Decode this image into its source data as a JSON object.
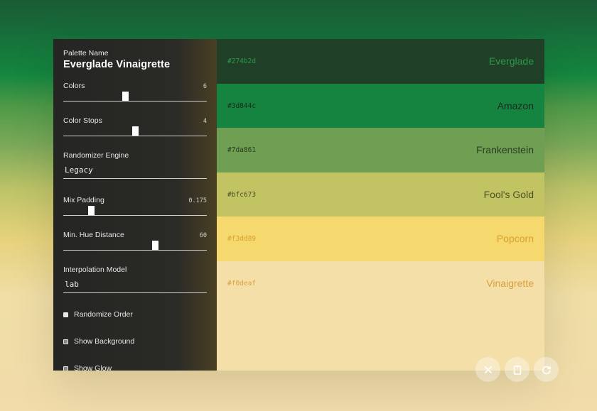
{
  "panel": {
    "title_label": "Palette Name",
    "title": "Everglade Vinaigrette",
    "colors": {
      "label": "Colors",
      "value": "6",
      "fraction": 0.43
    },
    "color_stops": {
      "label": "Color Stops",
      "value": "4",
      "fraction": 0.5
    },
    "randomizer": {
      "label": "Randomizer Engine",
      "value": "Legacy"
    },
    "mix_padding": {
      "label": "Mix Padding",
      "value": "0.175",
      "fraction": 0.18
    },
    "hue_distance": {
      "label": "Min. Hue Distance",
      "value": "60",
      "fraction": 0.65
    },
    "interpolation": {
      "label": "Interpolation Model",
      "value": "lab"
    },
    "checks": [
      {
        "label": "Randomize Order",
        "checked": false
      },
      {
        "label": "Show Background",
        "checked": true
      },
      {
        "label": "Show Glow",
        "checked": true
      }
    ]
  },
  "swatches": [
    {
      "hex": "#274b2d",
      "name": "Everglade",
      "bg": "#1f3f27",
      "fg": "#2f9a4a"
    },
    {
      "hex": "#3d844c",
      "name": "Amazon",
      "bg": "#148440",
      "fg": "#1b2a1c"
    },
    {
      "hex": "#7da861",
      "name": "Frankenstein",
      "bg": "#6f9f52",
      "fg": "#2b3a23"
    },
    {
      "hex": "#bfc673",
      "name": "Fool's Gold",
      "bg": "#c2c464",
      "fg": "#4f5026"
    },
    {
      "hex": "#f3dd89",
      "name": "Popcorn",
      "bg": "#f5d86e",
      "fg": "#d9a12a"
    },
    {
      "hex": "#f0deaf",
      "name": "Vinaigrette",
      "bg": "#f4dfa8",
      "fg": "#d8a23c"
    }
  ],
  "actions": {
    "close_icon": "close-icon",
    "copy_icon": "clipboard-icon",
    "refresh_icon": "refresh-icon"
  }
}
